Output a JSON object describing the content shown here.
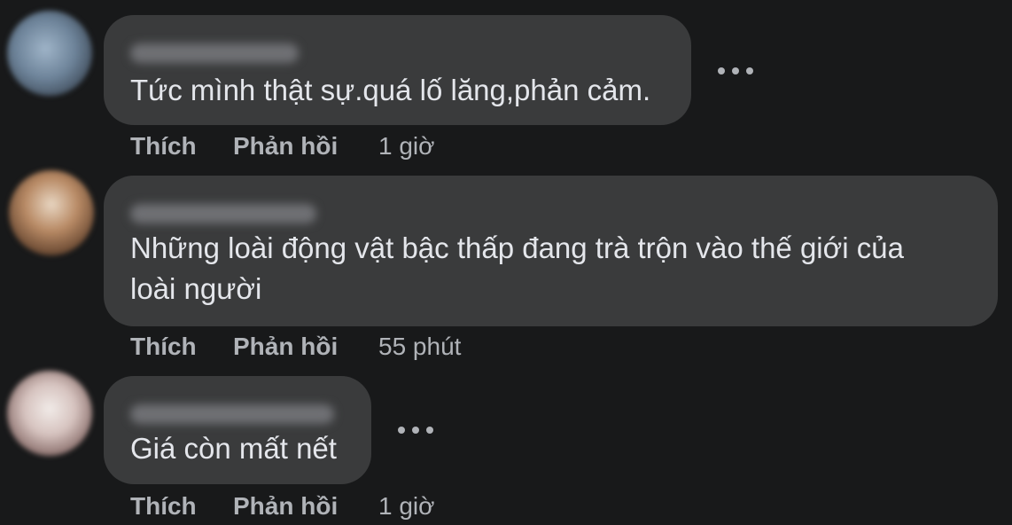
{
  "comments": [
    {
      "text": "Tức mình thật sự.quá lố lăng,phản cảm.",
      "like_label": "Thích",
      "reply_label": "Phản hồi",
      "time": "1 giờ"
    },
    {
      "text": "Những loài động vật bậc thấp đang trà trộn vào thế giới của\nloài người",
      "like_label": "Thích",
      "reply_label": "Phản hồi",
      "time": "55 phút"
    },
    {
      "text": "Giá còn mất nết",
      "like_label": "Thích",
      "reply_label": "Phản hồi",
      "time": "1 giờ"
    }
  ],
  "colors": {
    "background": "#18191a",
    "bubble": "#3a3b3c",
    "text": "#e4e6eb",
    "secondary": "#b0b3b8"
  },
  "icons": {
    "more_options": "more-options-icon"
  }
}
